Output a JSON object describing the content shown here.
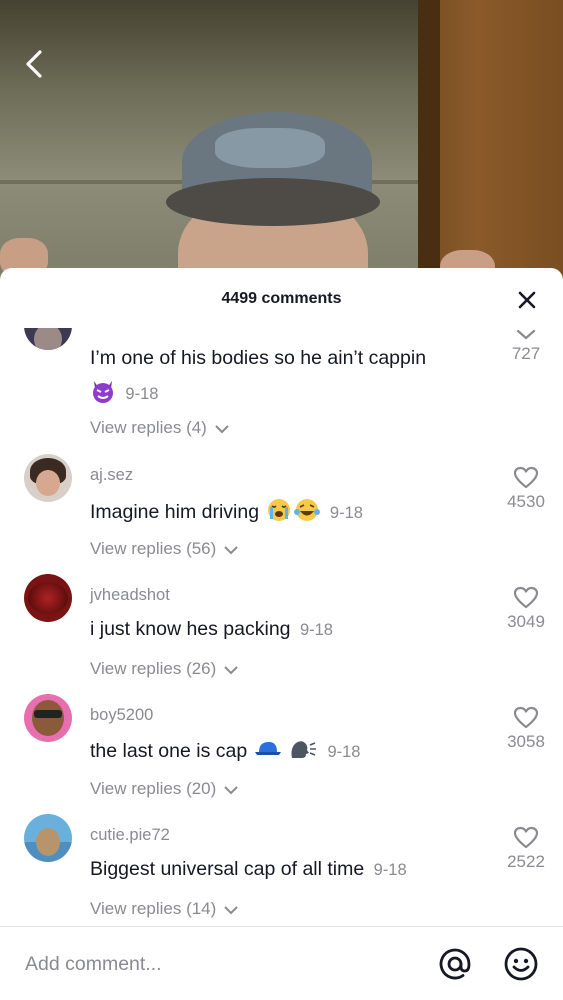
{
  "header": {
    "comment_count": "4499 comments"
  },
  "comments": [
    {
      "username": "",
      "text": "I’m one of his bodies so he ain’t cappin",
      "date": "9-18",
      "replies": "View replies (4)",
      "likes": "727",
      "emoji": "devil-face"
    },
    {
      "username": "aj.sez",
      "text": "Imagine him driving",
      "date": "9-18",
      "replies": "View replies (56)",
      "likes": "4530",
      "emoji": [
        "crying-face",
        "laughing-tears-face"
      ]
    },
    {
      "username": "jvheadshot",
      "text": "i just know hes packing",
      "date": "9-18",
      "replies": "View replies (26)",
      "likes": "3049"
    },
    {
      "username": "boy5200",
      "text": "the last one is cap",
      "date": "9-18",
      "replies": "View replies (20)",
      "likes": "3058",
      "emoji": [
        "blue-cap",
        "speaking-head"
      ]
    },
    {
      "username": "cutie.pie72",
      "text": "Biggest universal cap of all time",
      "date": "9-18",
      "replies": "View replies (14)",
      "likes": "2522"
    }
  ],
  "input": {
    "placeholder": "Add comment..."
  },
  "icons": {
    "back": "back-chevron-icon",
    "close": "close-icon",
    "like": "heart-outline-icon",
    "mention": "at-sign-icon",
    "emoji": "smiley-icon"
  },
  "colors": {
    "text_primary": "#161823",
    "text_secondary": "#8a8b91",
    "sheet_bg": "#ffffff"
  }
}
